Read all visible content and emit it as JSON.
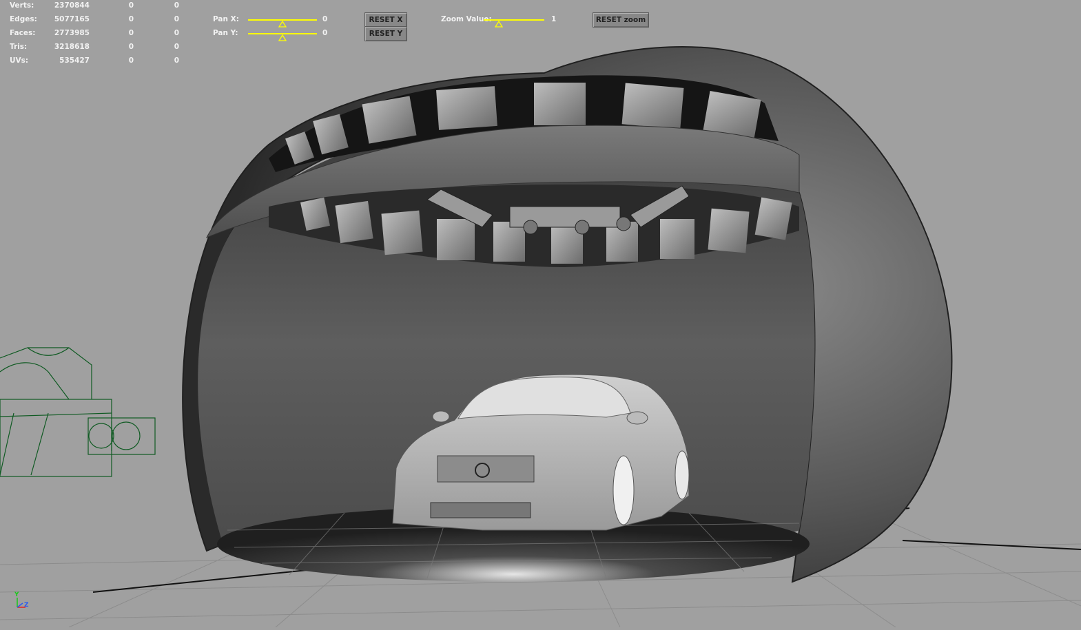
{
  "stats": [
    {
      "label": "Verts:",
      "value": "2370844",
      "selected": "0",
      "component": "0"
    },
    {
      "label": "Edges:",
      "value": "5077165",
      "selected": "0",
      "component": "0"
    },
    {
      "label": "Faces:",
      "value": "2773985",
      "selected": "0",
      "component": "0"
    },
    {
      "label": "Tris:",
      "value": "3218618",
      "selected": "0",
      "component": "0"
    },
    {
      "label": "UVs:",
      "value": "535427",
      "selected": "0",
      "component": "0"
    }
  ],
  "controls": {
    "pan_x_label": "Pan X:",
    "pan_x_value": "0",
    "pan_y_label": "Pan Y:",
    "pan_y_value": "0",
    "reset_x": "RESET X",
    "reset_y": "RESET Y",
    "zoom_label": "Zoom Value:",
    "zoom_value": "1",
    "reset_zoom": "RESET zoom",
    "pan_x_fraction": 0.5,
    "pan_y_fraction": 0.5,
    "zoom_fraction": 0.25
  },
  "axis": {
    "y": "Y",
    "z": "Z",
    "x_icon": "axis-gizmo-icon"
  },
  "colors": {
    "background": "#a0a0a0",
    "slider": "#ffff00",
    "wireframe": "#0f5a22",
    "hud_text": "#f2f2f2"
  }
}
